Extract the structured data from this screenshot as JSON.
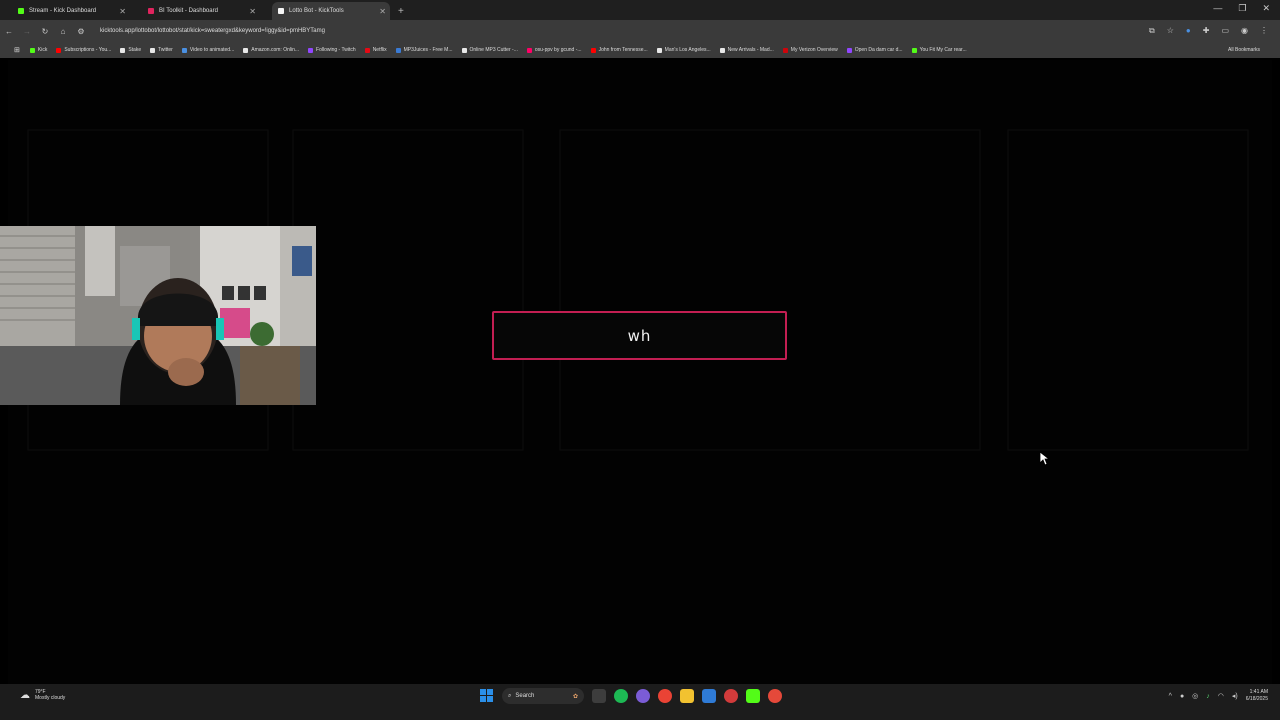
{
  "browser": {
    "tabs": [
      {
        "label": "Stream - Kick Dashboard",
        "color": "#53fc18"
      },
      {
        "label": "BI Toolkit - Dashboard",
        "color": "#e0245e"
      },
      {
        "label": "Lotto Bot - KickTools",
        "color": "#f5f5f5"
      }
    ],
    "active_tab": 2,
    "url": "kicktools.app/lottobot/lottobot/stat/kick=sweatergxd&keyword=!iggy&id=pmHBYTamg",
    "bookmarks": [
      {
        "label": "Kick",
        "color": "#53fc18"
      },
      {
        "label": "Subscriptions - You...",
        "color": "#ff0000"
      },
      {
        "label": "Stake",
        "color": "#e8e8e8"
      },
      {
        "label": "Twitter",
        "color": "#e8e8e8"
      },
      {
        "label": "Video to animated...",
        "color": "#4a90e2"
      },
      {
        "label": "Amazon.com: Onlin...",
        "color": "#e8e8e8"
      },
      {
        "label": "Following - Twitch",
        "color": "#9146ff"
      },
      {
        "label": "Netflix",
        "color": "#e50914"
      },
      {
        "label": "MP3Juices - Free M...",
        "color": "#3a7bd5"
      },
      {
        "label": "Online MP3 Cutter -...",
        "color": "#e8e8e8"
      },
      {
        "label": "osu-ppv by gcund -...",
        "color": "#f06"
      },
      {
        "label": "John from Tennesse...",
        "color": "#ff0000"
      },
      {
        "label": "Man's Los Angeles...",
        "color": "#e8e8e8"
      },
      {
        "label": "New Arrivals - Mad...",
        "color": "#e8e8e8"
      },
      {
        "label": "My Verizon Overview",
        "color": "#cd040b"
      },
      {
        "label": "Open Da dam car d...",
        "color": "#9146ff"
      },
      {
        "label": "You Fit My Car rear...",
        "color": "#53fc18"
      }
    ],
    "all_bookmarks": "All Bookmarks"
  },
  "overlay": {
    "modal_text": "wh"
  },
  "taskbar": {
    "weather_temp": "79°F",
    "weather_desc": "Mostly cloudy",
    "search_label": "Search",
    "time": "1:41 AM",
    "date": "6/18/2025"
  }
}
